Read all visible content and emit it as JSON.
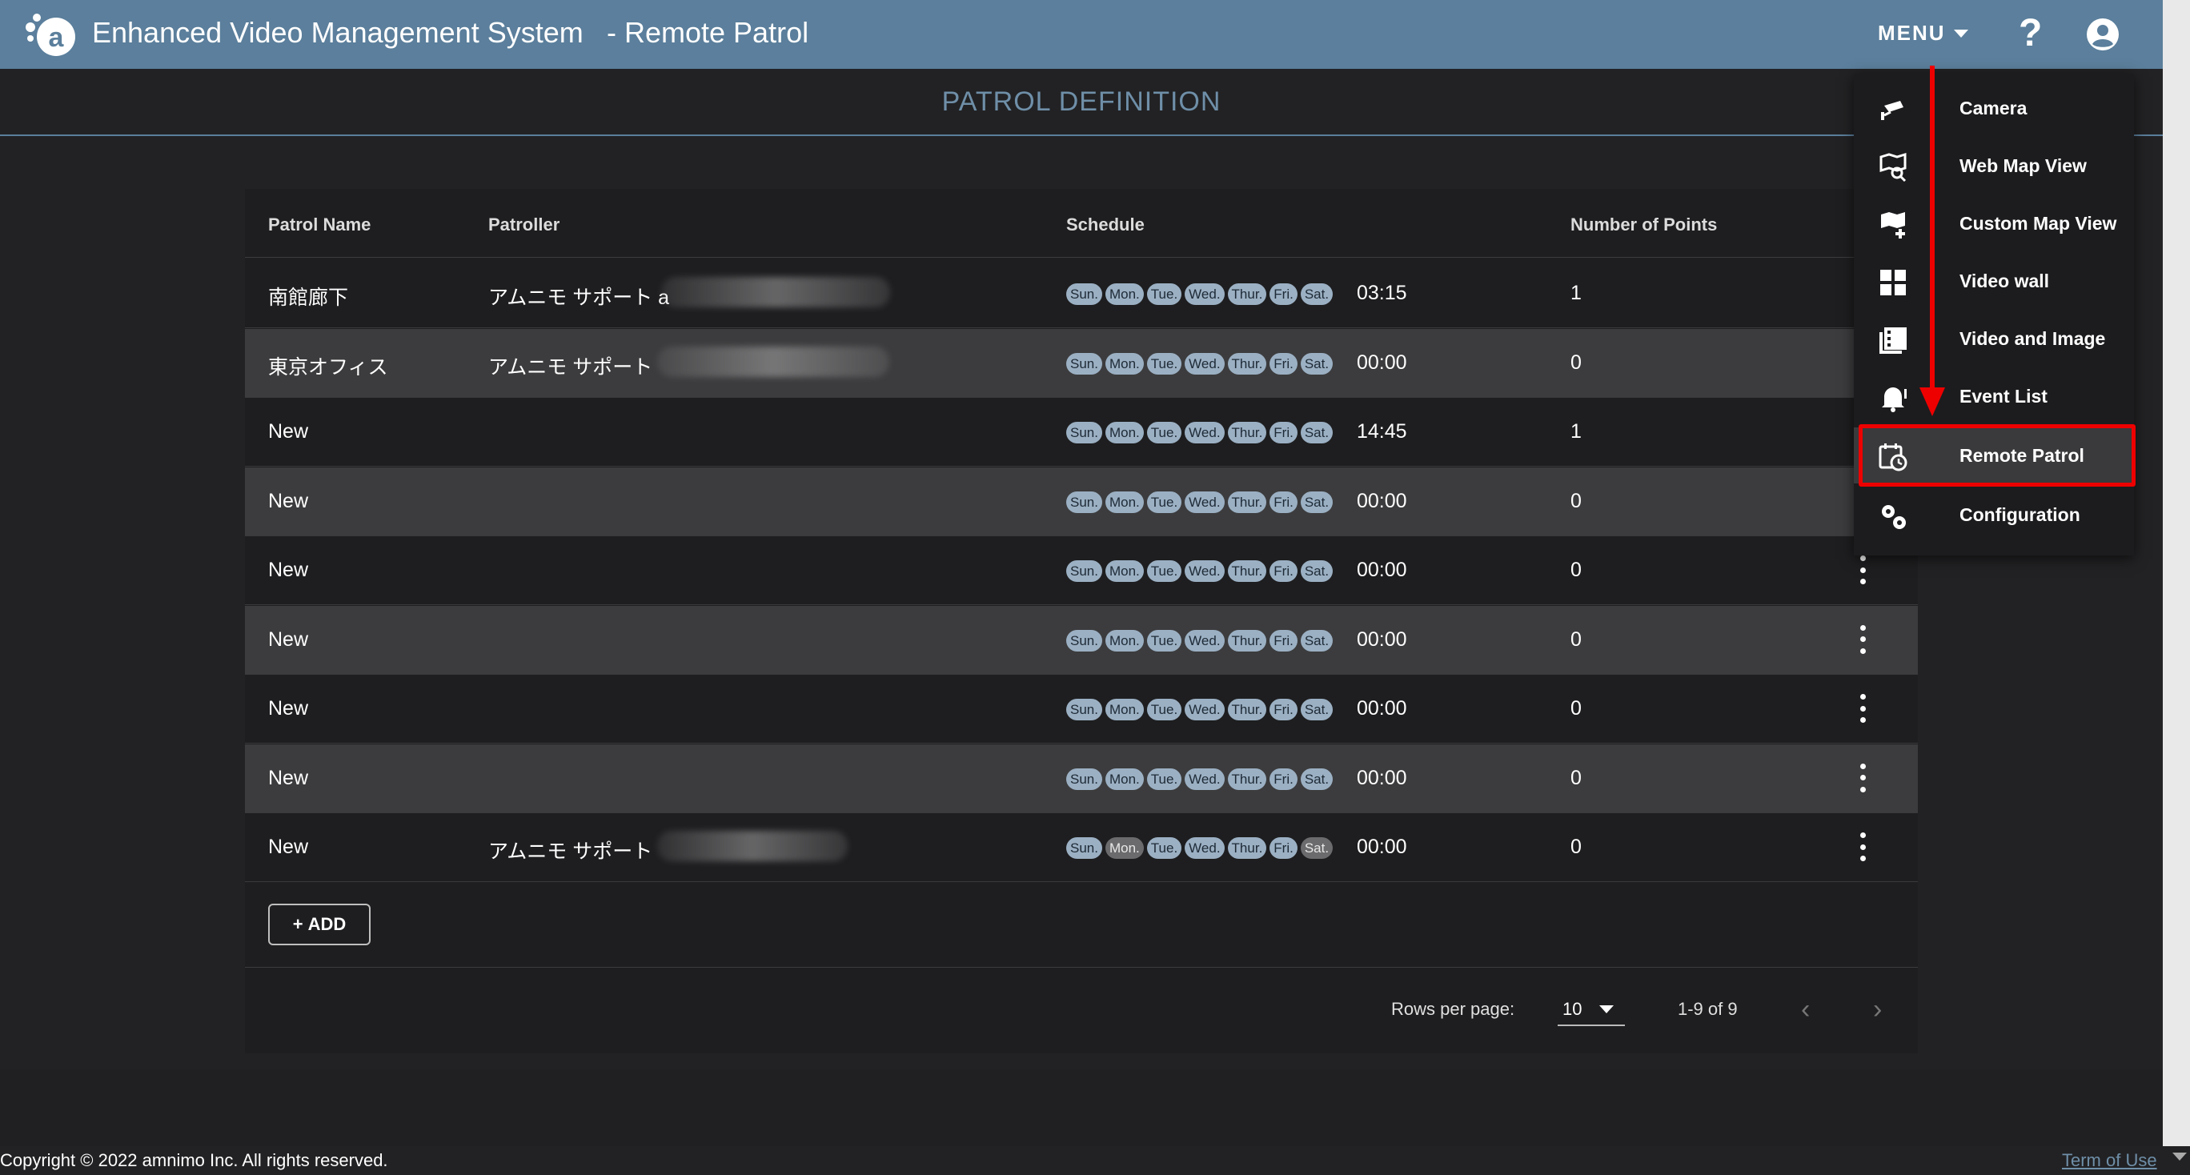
{
  "header": {
    "app_title": "Enhanced Video Management System",
    "sub_title": "- Remote Patrol",
    "menu_label": "MENU",
    "help_label": "?"
  },
  "page_title": "PATROL DEFINITION",
  "table": {
    "columns": [
      "Patrol Name",
      "Patroller",
      "Schedule",
      "Number of Points"
    ],
    "day_labels": [
      "Sun.",
      "Mon.",
      "Tue.",
      "Wed.",
      "Thur.",
      "Fri.",
      "Sat."
    ],
    "rows": [
      {
        "name": "南館廊下",
        "patroller": "アムニモ サポート a",
        "days_on": [
          true,
          true,
          true,
          true,
          true,
          true,
          true
        ],
        "time": "03:15",
        "points": "1"
      },
      {
        "name": "東京オフィス",
        "patroller": "アムニモ サポート",
        "days_on": [
          true,
          true,
          true,
          true,
          true,
          true,
          true
        ],
        "time": "00:00",
        "points": "0"
      },
      {
        "name": "New",
        "patroller": "",
        "days_on": [
          true,
          true,
          true,
          true,
          true,
          true,
          true
        ],
        "time": "14:45",
        "points": "1"
      },
      {
        "name": "New",
        "patroller": "",
        "days_on": [
          true,
          true,
          true,
          true,
          true,
          true,
          true
        ],
        "time": "00:00",
        "points": "0"
      },
      {
        "name": "New",
        "patroller": "",
        "days_on": [
          true,
          true,
          true,
          true,
          true,
          true,
          true
        ],
        "time": "00:00",
        "points": "0"
      },
      {
        "name": "New",
        "patroller": "",
        "days_on": [
          true,
          true,
          true,
          true,
          true,
          true,
          true
        ],
        "time": "00:00",
        "points": "0"
      },
      {
        "name": "New",
        "patroller": "",
        "days_on": [
          true,
          true,
          true,
          true,
          true,
          true,
          true
        ],
        "time": "00:00",
        "points": "0"
      },
      {
        "name": "New",
        "patroller": "",
        "days_on": [
          true,
          true,
          true,
          true,
          true,
          true,
          true
        ],
        "time": "00:00",
        "points": "0"
      },
      {
        "name": "New",
        "patroller": "アムニモ サポート",
        "days_on": [
          true,
          false,
          true,
          true,
          true,
          true,
          false
        ],
        "time": "00:00",
        "points": "0"
      }
    ]
  },
  "add_button_label": "ADD",
  "pagination": {
    "rows_per_page_label": "Rows per page:",
    "rows_per_page_value": "10",
    "range_label": "1-9 of 9"
  },
  "menu": {
    "items": [
      {
        "label": "Camera",
        "icon": "cctv-camera-icon"
      },
      {
        "label": "Web Map View",
        "icon": "map-search-icon"
      },
      {
        "label": "Custom Map View",
        "icon": "map-plus-icon"
      },
      {
        "label": "Video wall",
        "icon": "grid-icon"
      },
      {
        "label": "Video and Image",
        "icon": "film-icon"
      },
      {
        "label": "Event List",
        "icon": "bell-alert-icon"
      },
      {
        "label": "Remote Patrol",
        "icon": "calendar-clock-icon"
      },
      {
        "label": "Configuration",
        "icon": "gears-icon"
      }
    ],
    "active_item": "Remote Patrol"
  },
  "footer": {
    "copyright": "Copyright © 2022 amnimo Inc. All rights reserved.",
    "terms_link": "Term of Use"
  },
  "colors": {
    "header_bg": "#5b7f9c",
    "page_bg": "#222224",
    "day_chip_on": "#9bb0c3",
    "day_chip_off": "#6b6b6d",
    "annotation_red": "#e00000"
  }
}
